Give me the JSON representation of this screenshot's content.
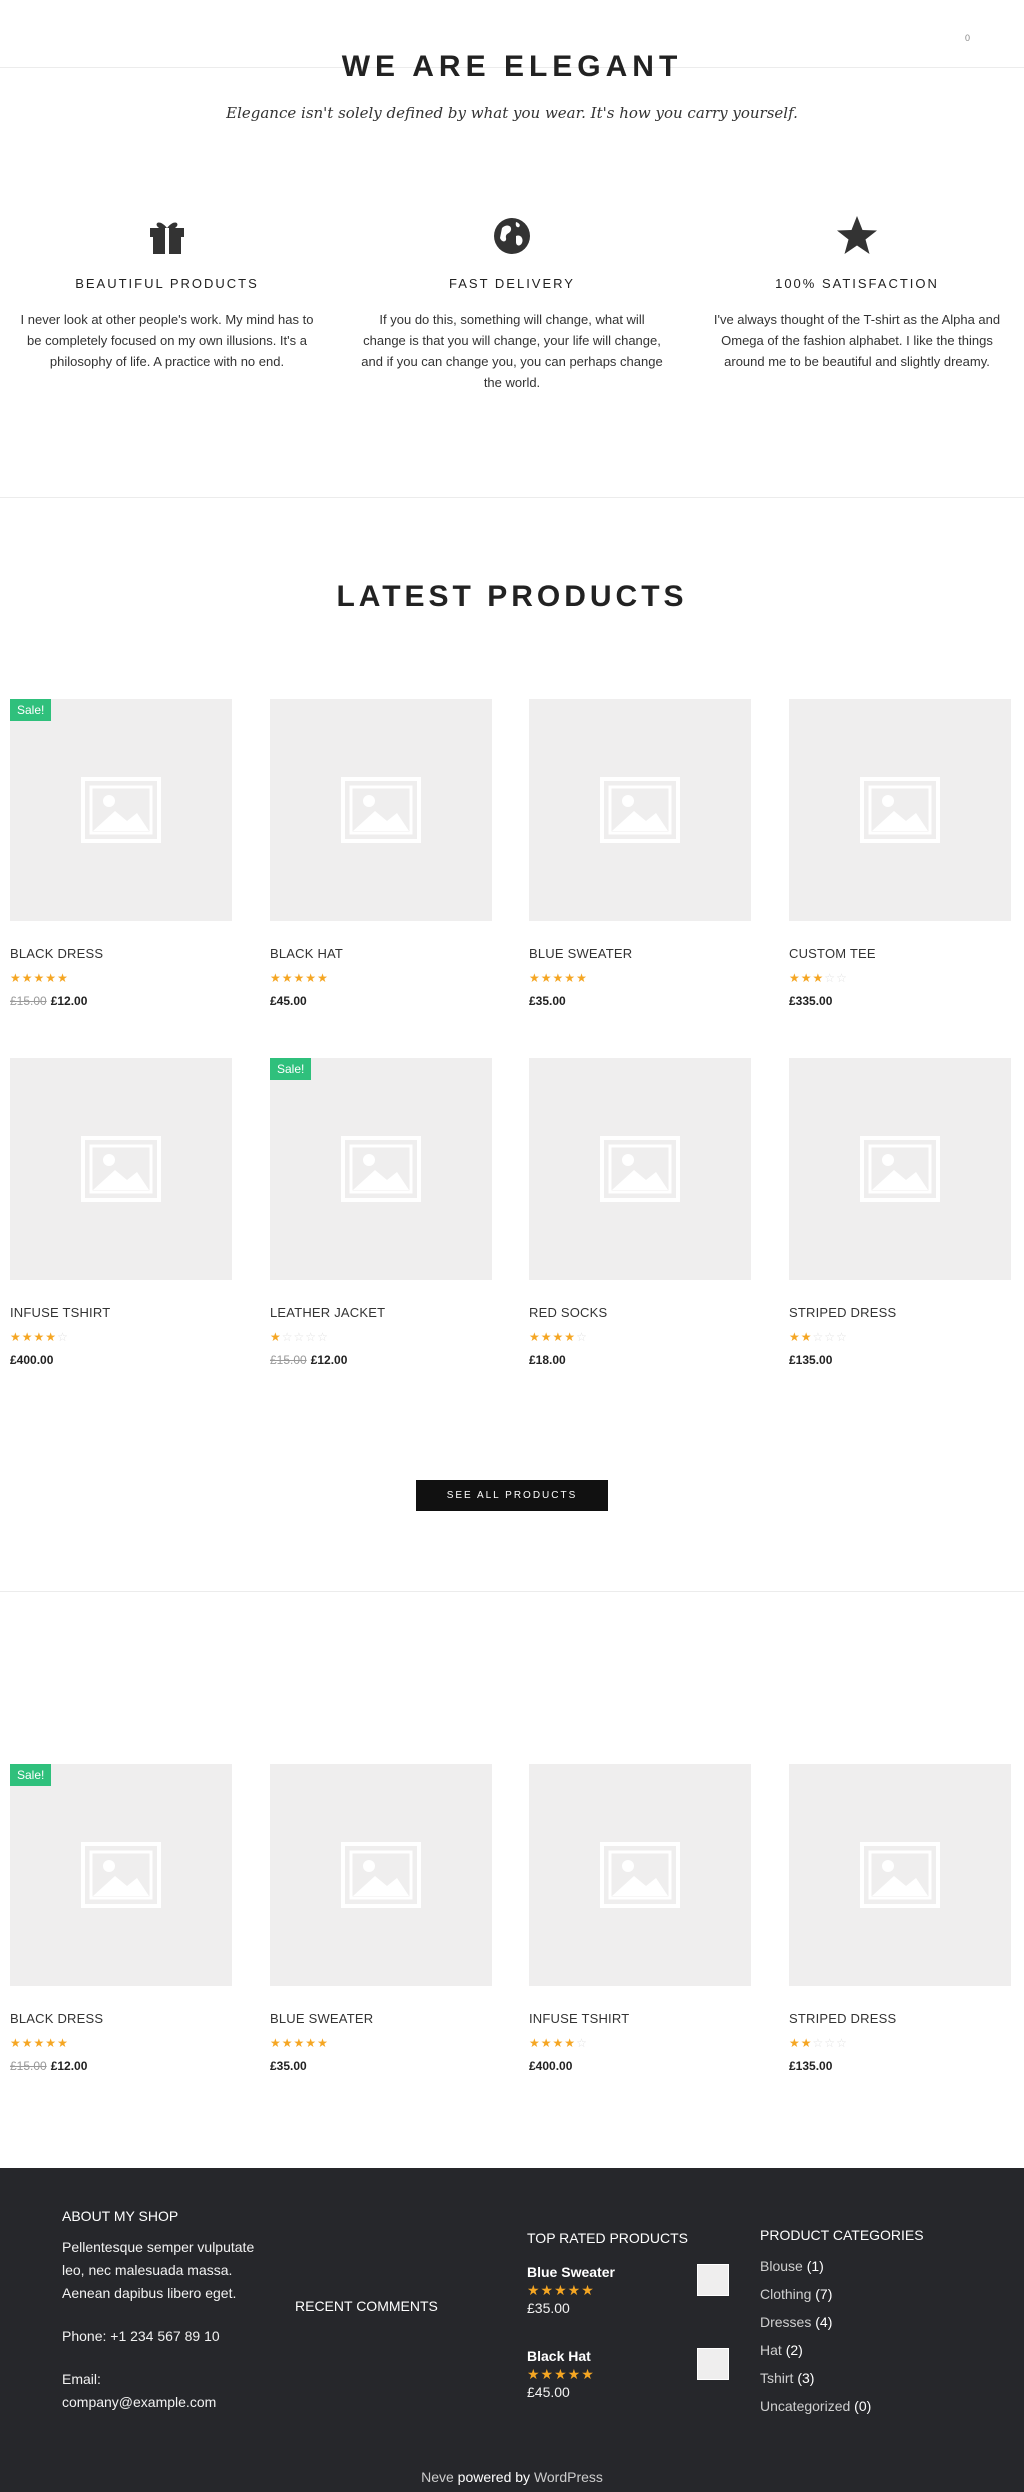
{
  "header": {
    "cart_count": "0"
  },
  "hero": {
    "title": "WE ARE ELEGANT",
    "subtitle": "Elegance isn't solely defined by what you wear. It's how you carry yourself."
  },
  "features": [
    {
      "icon": "gift-icon",
      "title": "BEAUTIFUL PRODUCTS",
      "text": "I never look at other people's work. My mind has to be completely focused on my own illusions. It's a philosophy of life. A practice with no end."
    },
    {
      "icon": "globe-icon",
      "title": "FAST DELIVERY",
      "text": "If you do this, something will change, what will change is that you will change, your life will change, and if you can change you, you can perhaps change the world."
    },
    {
      "icon": "star-icon",
      "title": "100% SATISFACTION",
      "text": "I've always thought of the T-shirt as the Alpha and Omega of the fashion alphabet. I like the things around me to be beautiful and slightly dreamy."
    }
  ],
  "latest": {
    "title": "LATEST PRODUCTS",
    "products": [
      {
        "name": "BLACK DRESS",
        "rating": 5,
        "old_price": "£15.00",
        "price": "£12.00",
        "sale": "Sale!"
      },
      {
        "name": "BLACK HAT",
        "rating": 5,
        "price": "£45.00"
      },
      {
        "name": "BLUE SWEATER",
        "rating": 5,
        "price": "£35.00"
      },
      {
        "name": "CUSTOM TEE",
        "rating": 3,
        "price": "£335.00"
      },
      {
        "name": "INFUSE TSHIRT",
        "rating": 4,
        "price": "£400.00"
      },
      {
        "name": "LEATHER JACKET",
        "rating": 1,
        "old_price": "£15.00",
        "price": "£12.00",
        "sale": "Sale!"
      },
      {
        "name": "RED SOCKS",
        "rating": 4,
        "price": "£18.00"
      },
      {
        "name": "STRIPED DRESS",
        "rating": 2,
        "price": "£135.00"
      }
    ],
    "see_all_label": "SEE ALL PRODUCTS"
  },
  "featured": {
    "products": [
      {
        "name": "BLACK DRESS",
        "rating": 5,
        "old_price": "£15.00",
        "price": "£12.00",
        "sale": "Sale!"
      },
      {
        "name": "BLUE SWEATER",
        "rating": 5,
        "price": "£35.00"
      },
      {
        "name": "INFUSE TSHIRT",
        "rating": 4,
        "price": "£400.00"
      },
      {
        "name": "STRIPED DRESS",
        "rating": 2,
        "price": "£135.00"
      }
    ]
  },
  "footer": {
    "about": {
      "title": "ABOUT MY SHOP",
      "text": "Pellentesque semper vulputate leo, nec malesuada massa. Aenean dapibus libero eget.",
      "phone": "Phone: +1 234 567 89 10",
      "email_label": "Email:",
      "email": "company@example.com"
    },
    "recent_comments": {
      "title": "RECENT COMMENTS"
    },
    "top_rated": {
      "title": "TOP RATED PRODUCTS",
      "items": [
        {
          "name": "Blue Sweater",
          "rating": 5,
          "price": "£35.00"
        },
        {
          "name": "Black Hat",
          "rating": 5,
          "price": "£45.00"
        }
      ]
    },
    "categories": {
      "title": "PRODUCT CATEGORIES",
      "items": [
        {
          "name": "Blouse",
          "count": "(1)"
        },
        {
          "name": "Clothing",
          "count": "(7)"
        },
        {
          "name": "Dresses",
          "count": "(4)"
        },
        {
          "name": "Hat",
          "count": "(2)"
        },
        {
          "name": "Tshirt",
          "count": "(3)"
        },
        {
          "name": "Uncategorized",
          "count": "(0)"
        }
      ]
    },
    "credit": {
      "theme": "Neve",
      "powered": "powered by",
      "platform": "WordPress"
    }
  },
  "colors": {
    "sale_badge": "#2fc07c",
    "star": "#f5a623",
    "footer_bg": "#26272b",
    "button_bg": "#111111"
  }
}
